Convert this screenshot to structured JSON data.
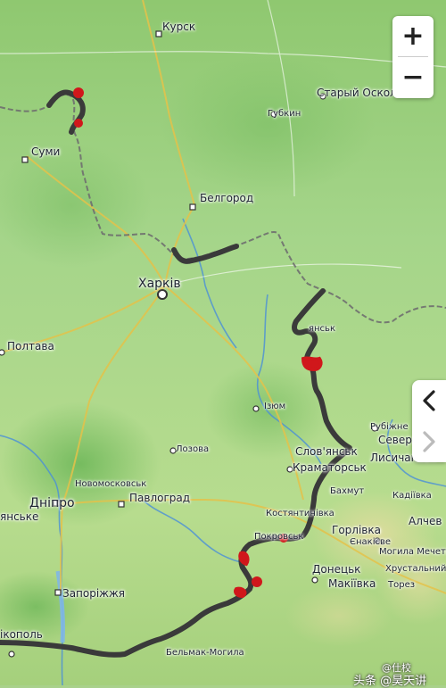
{
  "map": {
    "cities": [
      {
        "id": "kursk",
        "name": "Курск"
      },
      {
        "id": "stary-oskol",
        "name": "Старый Оскол"
      },
      {
        "id": "gubkin",
        "name": "Губкин"
      },
      {
        "id": "sumy",
        "name": "Суми"
      },
      {
        "id": "belgorod",
        "name": "Белгород"
      },
      {
        "id": "kharkiv",
        "name": "Харків"
      },
      {
        "id": "poltava",
        "name": "Полтава"
      },
      {
        "id": "izium",
        "name": "Ізюм"
      },
      {
        "id": "lozova",
        "name": "Лозова"
      },
      {
        "id": "rubizhne",
        "name": "Рубіжне"
      },
      {
        "id": "sievierodonetsk",
        "name": "Север"
      },
      {
        "id": "lysychansk",
        "name": "Лисичанськ"
      },
      {
        "id": "sloviansk",
        "name": "Слов'янськ"
      },
      {
        "id": "kramatorsk",
        "name": "Краматорськ"
      },
      {
        "id": "novomoskovsk",
        "name": "Новомосковськ"
      },
      {
        "id": "pavlohrad",
        "name": "Павлоград"
      },
      {
        "id": "dnipro",
        "name": "Дніпро"
      },
      {
        "id": "kamianske",
        "name": "янське"
      },
      {
        "id": "bakhmut",
        "name": "Бахмут"
      },
      {
        "id": "kadiivka",
        "name": "Кадіївка"
      },
      {
        "id": "alchevsk",
        "name": "Алчев"
      },
      {
        "id": "kostiantynivka",
        "name": "Костянтинівка"
      },
      {
        "id": "horlivka",
        "name": "Горлівка"
      },
      {
        "id": "yenakiieve",
        "name": "Єнакієве"
      },
      {
        "id": "pokrovsk",
        "name": "Покровськ"
      },
      {
        "id": "mohyla-mechetna",
        "name": "Могила Мечетна"
      },
      {
        "id": "khrustalnyi",
        "name": "Хрустальний"
      },
      {
        "id": "donetsk",
        "name": "Донецьк"
      },
      {
        "id": "makiivka",
        "name": "Макіївка"
      },
      {
        "id": "torez",
        "name": "Торез"
      },
      {
        "id": "zaporizhzhia",
        "name": "Запоріжжя"
      },
      {
        "id": "bilmak",
        "name": "Бельмак-Могила"
      },
      {
        "id": "nikopol",
        "name": "ікополь"
      },
      {
        "id": "slovyansk-partial",
        "name": "янськ"
      }
    ]
  },
  "controls": {
    "zoom_in": "+",
    "zoom_out": "−"
  },
  "watermark": {
    "text": "头条 @昊天讲"
  },
  "watermark2": {
    "text": "@仕校"
  },
  "colors": {
    "frontline": "#3a3a3a",
    "gains": "#d0171b",
    "river": "#4a8fd8",
    "border": "#6f6f6f",
    "water": "#7fb7e6"
  }
}
